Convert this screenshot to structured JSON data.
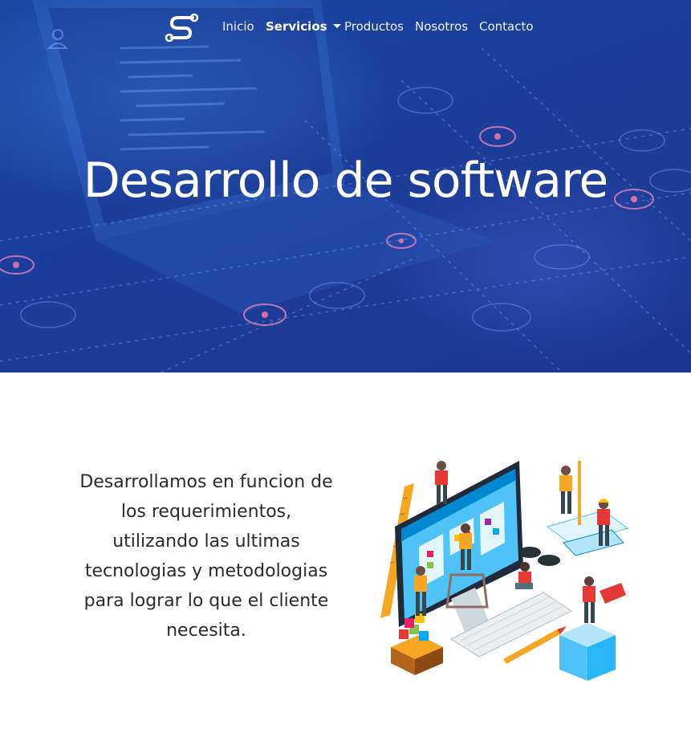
{
  "nav": {
    "logo_icon": "s-connector-logo-icon",
    "items": [
      {
        "label": "Inicio"
      },
      {
        "label": "Servicios",
        "active": true,
        "dropdown": true
      },
      {
        "label": "Productos"
      },
      {
        "label": "Nosotros"
      },
      {
        "label": "Contacto"
      }
    ]
  },
  "hero": {
    "title": "Desarrollo de software",
    "background": "blue-tech-laptop-image"
  },
  "main": {
    "description": "Desarrollamos en funcion de los requerimientos, utilizando las ultimas tecnologias y metodologias para lograr lo que el cliente necesita.",
    "illustration": "isometric-software-team-illustration"
  },
  "colors": {
    "hero_blue": "#1b46a6",
    "text_dark": "#2b2b2b",
    "accent_orange": "#f39c12",
    "accent_red": "#e53935"
  }
}
